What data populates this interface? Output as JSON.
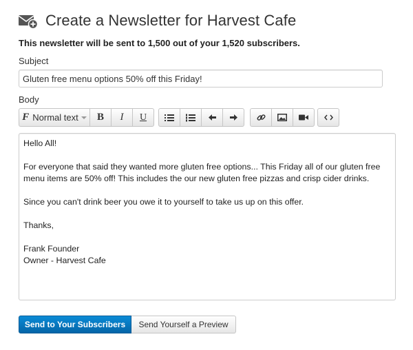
{
  "header": {
    "title": "Create a Newsletter for Harvest Cafe",
    "icon": "envelope-plus-icon"
  },
  "notice": "This newsletter will be sent to 1,500 out of your 1,520 subscribers.",
  "subject": {
    "label": "Subject",
    "value": "Gluten free menu options 50% off this Friday!"
  },
  "body": {
    "label": "Body",
    "content": "Hello All!\n\nFor everyone that said they wanted more gluten free options... This Friday all of our gluten free menu items are 50% off! This includes the our new gluten free pizzas and crisp cider drinks.\n\nSince you can't drink beer you owe it to yourself to take us up on this offer.\n\nThanks,\n\nFrank Founder\nOwner - Harvest Cafe"
  },
  "toolbar": {
    "font_style": "Normal text",
    "bold": "B",
    "italic": "I",
    "underline": "U"
  },
  "buttons": {
    "send": "Send to Your Subscribers",
    "preview": "Send Yourself a Preview"
  },
  "colors": {
    "primary": "#0a7bc4",
    "border": "#cccccc",
    "text": "#333333"
  }
}
